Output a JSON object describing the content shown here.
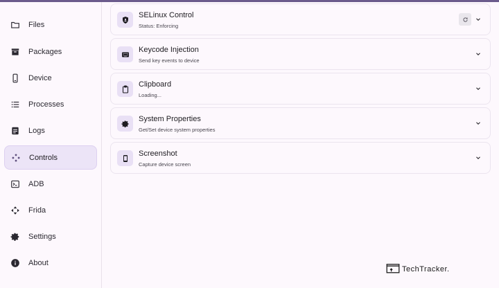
{
  "sidebar": {
    "items": [
      {
        "label": "Files",
        "icon": "folder-icon",
        "active": false
      },
      {
        "label": "Packages",
        "icon": "package-icon",
        "active": false
      },
      {
        "label": "Device",
        "icon": "phone-icon",
        "active": false
      },
      {
        "label": "Processes",
        "icon": "list-icon",
        "active": false
      },
      {
        "label": "Logs",
        "icon": "document-icon",
        "active": false
      },
      {
        "label": "Controls",
        "icon": "gamepad-icon",
        "active": true
      },
      {
        "label": "ADB",
        "icon": "terminal-icon",
        "active": false
      },
      {
        "label": "Frida",
        "icon": "frida-icon",
        "active": false
      },
      {
        "label": "Settings",
        "icon": "gear-icon",
        "active": false
      },
      {
        "label": "About",
        "icon": "info-icon",
        "active": false
      }
    ]
  },
  "controls": [
    {
      "title": "SELinux Control",
      "subtitle": "Status: Enforcing",
      "icon": "shield-icon",
      "has_refresh": true
    },
    {
      "title": "Keycode Injection",
      "subtitle": "Send key events to device",
      "icon": "keyboard-icon",
      "has_refresh": false
    },
    {
      "title": "Clipboard",
      "subtitle": "Loading...",
      "icon": "clipboard-icon",
      "has_refresh": false
    },
    {
      "title": "System Properties",
      "subtitle": "Get/Set device system properties",
      "icon": "gear-icon",
      "has_refresh": false
    },
    {
      "title": "Screenshot",
      "subtitle": "Capture device screen",
      "icon": "phone-icon",
      "has_refresh": false
    }
  ],
  "watermark": {
    "text": "TechTracker."
  },
  "colors": {
    "accent": "#6b5b8c",
    "active_bg": "#ece4f7",
    "icon_bg": "#e9e0f5"
  }
}
